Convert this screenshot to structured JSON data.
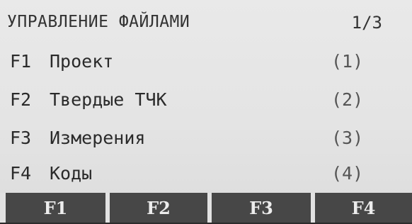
{
  "header": {
    "title": "УПРАВЛЕНИЕ ФАЙЛАМИ",
    "page": "1/3"
  },
  "menu": [
    {
      "fkey": "F1",
      "label": "Проект",
      "number": "(1)"
    },
    {
      "fkey": "F2",
      "label": "Твердые ТЧК",
      "number": "(2)"
    },
    {
      "fkey": "F3",
      "label": "Измерения",
      "number": "(3)"
    },
    {
      "fkey": "F4",
      "label": "Коды",
      "number": "(4)"
    }
  ],
  "softkeys": [
    "F1",
    "F2",
    "F3",
    "F4"
  ]
}
